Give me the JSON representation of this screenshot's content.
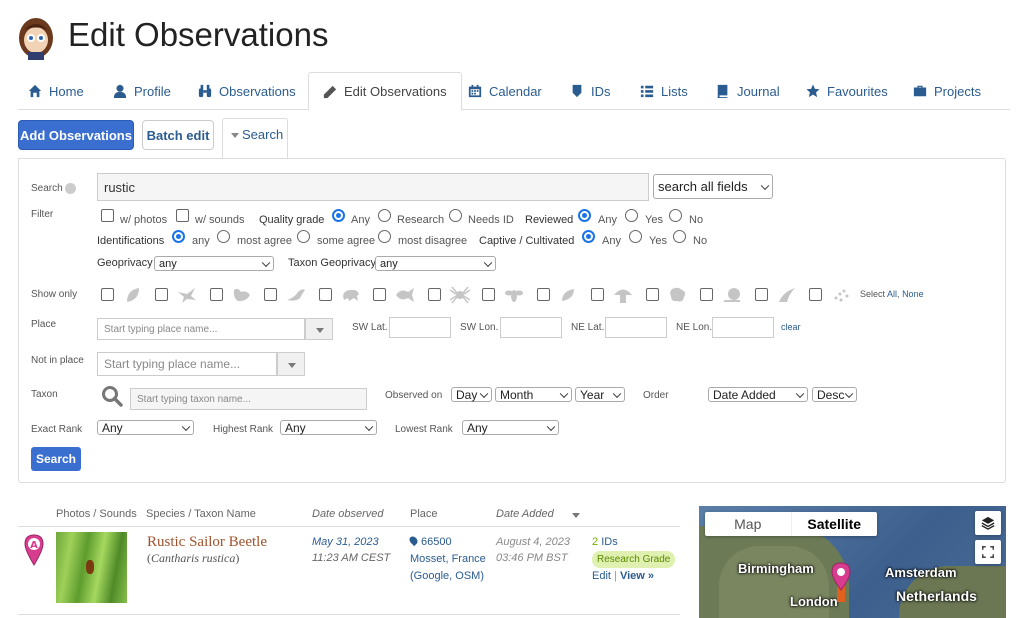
{
  "header": {
    "title": "Edit Observations"
  },
  "nav": {
    "tabs": [
      {
        "label": "Home",
        "icon": "home-icon"
      },
      {
        "label": "Profile",
        "icon": "user-icon"
      },
      {
        "label": "Observations",
        "icon": "binoculars-icon"
      },
      {
        "label": "Edit Observations",
        "icon": "pencil-icon",
        "active": true
      },
      {
        "label": "Calendar",
        "icon": "calendar-icon"
      },
      {
        "label": "IDs",
        "icon": "tag-icon"
      },
      {
        "label": "Lists",
        "icon": "list-icon"
      },
      {
        "label": "Journal",
        "icon": "book-icon"
      },
      {
        "label": "Favourites",
        "icon": "star-icon"
      },
      {
        "label": "Projects",
        "icon": "briefcase-icon"
      }
    ]
  },
  "actions": {
    "add": "Add Observations",
    "batch": "Batch edit",
    "search_tab": "Search"
  },
  "search": {
    "label": "Search",
    "query": "rustic",
    "field_select": "search all fields",
    "filter_label": "Filter",
    "photos": "w/ photos",
    "sounds": "w/ sounds",
    "quality_label": "Quality grade",
    "quality_options": [
      "Any",
      "Research",
      "Needs ID"
    ],
    "reviewed_label": "Reviewed",
    "reviewed_options": [
      "Any",
      "Yes",
      "No"
    ],
    "identifications_label": "Identifications",
    "identifications_options": [
      "any",
      "most agree",
      "some agree",
      "most disagree"
    ],
    "captive_label": "Captive / Cultivated",
    "captive_options": [
      "Any",
      "Yes",
      "No"
    ],
    "geoprivacy_label": "Geoprivacy",
    "geoprivacy_value": "any",
    "taxon_geoprivacy_label": "Taxon Geoprivacy",
    "taxon_geoprivacy_value": "any",
    "show_only_label": "Show only",
    "select_label": "Select",
    "all_link": "All",
    "none_link": "None",
    "place_label": "Place",
    "place_placeholder": "Start typing place name...",
    "sw_lat": "SW Lat.",
    "sw_lon": "SW Lon.",
    "ne_lat": "NE Lat.",
    "ne_lon": "NE Lon.",
    "clear": "clear",
    "not_in_place_label": "Not in place",
    "not_in_place_placeholder": "Start typing place name...",
    "taxon_label": "Taxon",
    "taxon_placeholder": "Start typing taxon name...",
    "observed_on_label": "Observed on",
    "day": "Day",
    "month": "Month",
    "year": "Year",
    "order_label": "Order",
    "order_by": "Date Added",
    "order_dir": "Desc",
    "exact_rank_label": "Exact Rank",
    "exact_rank_value": "Any",
    "highest_rank_label": "Highest Rank",
    "highest_rank_value": "Any",
    "lowest_rank_label": "Lowest Rank",
    "lowest_rank_value": "Any",
    "search_button": "Search"
  },
  "results": {
    "columns": [
      "Photos / Sounds",
      "Species / Taxon Name",
      "Date observed",
      "Place",
      "Date Added"
    ],
    "rows": [
      {
        "marker": "A",
        "common_name": "Rustic Sailor Beetle",
        "sci_name": "Cantharis rustica",
        "date_observed": "May 31, 2023",
        "time_observed": "11:23 AM CEST",
        "place_code": "66500",
        "place_name": "Mosset, France",
        "place_google": "Google",
        "place_osm": "OSM",
        "date_added": "August 4, 2023",
        "time_added": "03:46 PM BST",
        "ids_count": "2",
        "ids_label": "IDs",
        "grade": "Research Grade",
        "edit": "Edit",
        "view": "View »"
      }
    ]
  },
  "map": {
    "map_btn": "Map",
    "satellite_btn": "Satellite",
    "cities": [
      "Birmingham",
      "London",
      "Amsterdam",
      "Netherlands"
    ]
  }
}
